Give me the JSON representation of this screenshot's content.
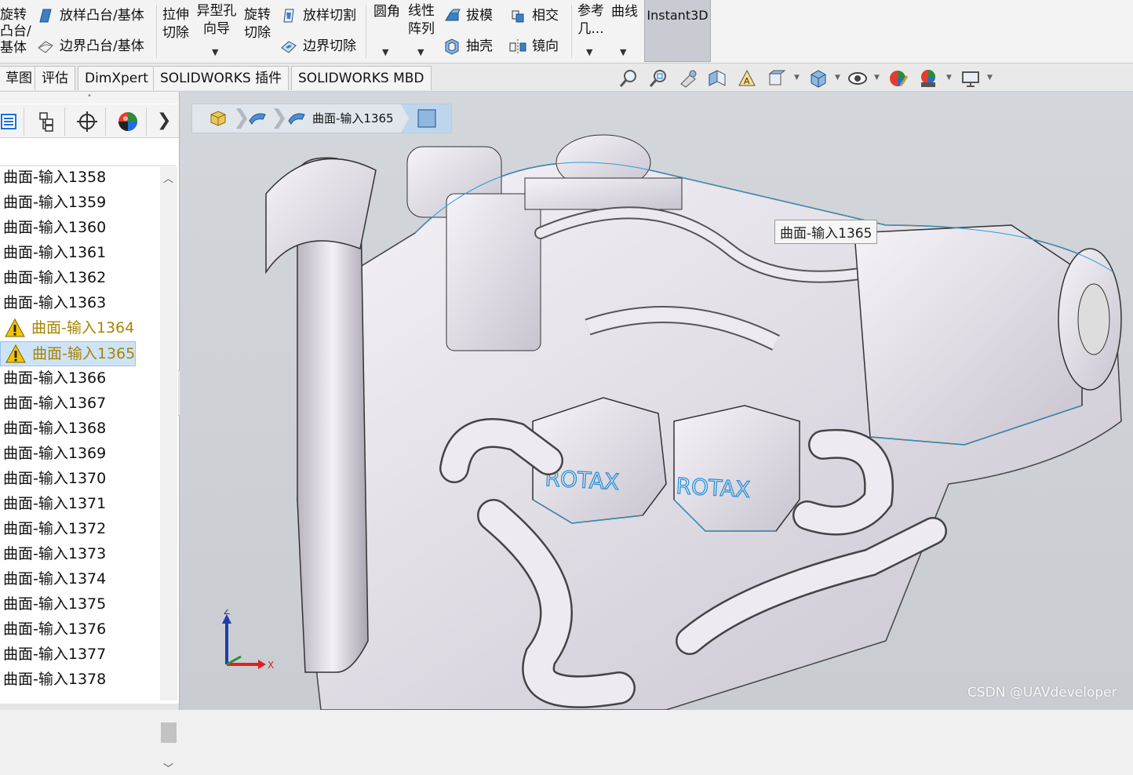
{
  "ribbon": {
    "col1": [
      "旋转",
      "凸台/",
      "基体"
    ],
    "loft_boss": "放样凸台/基体",
    "boundary_boss": "边界凸台/基体",
    "extrude_cut": [
      "拉伸",
      "切除"
    ],
    "hole_wizard": [
      "异型孔",
      "向导"
    ],
    "revolve_cut": [
      "旋转",
      "切除"
    ],
    "loft_cut": "放样切割",
    "boundary_cut": "边界切除",
    "fillet": "圆角",
    "linear_pattern": [
      "线性",
      "阵列"
    ],
    "draft": "拔模",
    "shell": "抽壳",
    "intersect": "相交",
    "mirror": "镜向",
    "ref_geometry": [
      "参考",
      "几..."
    ],
    "curves": "曲线",
    "instant3d": "Instant3D"
  },
  "tabs": [
    "草图",
    "评估",
    "DimXpert",
    "SOLIDWORKS 插件",
    "SOLIDWORKS MBD"
  ],
  "hud_icons": [
    "zoom-to-fit-icon",
    "zoom-area-icon",
    "previous-view-icon",
    "section-view-icon",
    "dynamic-annotation-icon",
    "view-orientation-icon",
    "display-style-icon",
    "hide-show-icon",
    "edit-appearance-icon",
    "apply-scene-icon",
    "view-settings-icon"
  ],
  "panel_tabs": [
    "feature-manager-icon",
    "property-manager-icon",
    "configuration-manager-icon",
    "display-manager-icon"
  ],
  "tree": [
    {
      "label": "曲面-输入1358",
      "warn": false
    },
    {
      "label": "曲面-输入1359",
      "warn": false
    },
    {
      "label": "曲面-输入1360",
      "warn": false
    },
    {
      "label": "曲面-输入1361",
      "warn": false
    },
    {
      "label": "曲面-输入1362",
      "warn": false
    },
    {
      "label": "曲面-输入1363",
      "warn": false
    },
    {
      "label": "曲面-输入1364",
      "warn": true
    },
    {
      "label": "曲面-输入1365",
      "warn": true,
      "selected": true
    },
    {
      "label": "曲面-输入1366",
      "warn": false
    },
    {
      "label": "曲面-输入1367",
      "warn": false
    },
    {
      "label": "曲面-输入1368",
      "warn": false
    },
    {
      "label": "曲面-输入1369",
      "warn": false
    },
    {
      "label": "曲面-输入1370",
      "warn": false
    },
    {
      "label": "曲面-输入1371",
      "warn": false
    },
    {
      "label": "曲面-输入1372",
      "warn": false
    },
    {
      "label": "曲面-输入1373",
      "warn": false
    },
    {
      "label": "曲面-输入1374",
      "warn": false
    },
    {
      "label": "曲面-输入1375",
      "warn": false
    },
    {
      "label": "曲面-输入1376",
      "warn": false
    },
    {
      "label": "曲面-输入1377",
      "warn": false
    },
    {
      "label": "曲面-输入1378",
      "warn": false
    }
  ],
  "breadcrumb": {
    "label": "曲面-输入1365"
  },
  "tooltip": "曲面-输入1365",
  "model": {
    "brand_text": "ROTAX"
  },
  "triad": {
    "x": "X",
    "z": "Z"
  },
  "watermark": "CSDN @UAVdeveloper",
  "colors": {
    "accent": "#1e6fd9",
    "warning": "#f5c400",
    "selection": "#cde3f7",
    "model_edge": "#2a9fd6"
  }
}
